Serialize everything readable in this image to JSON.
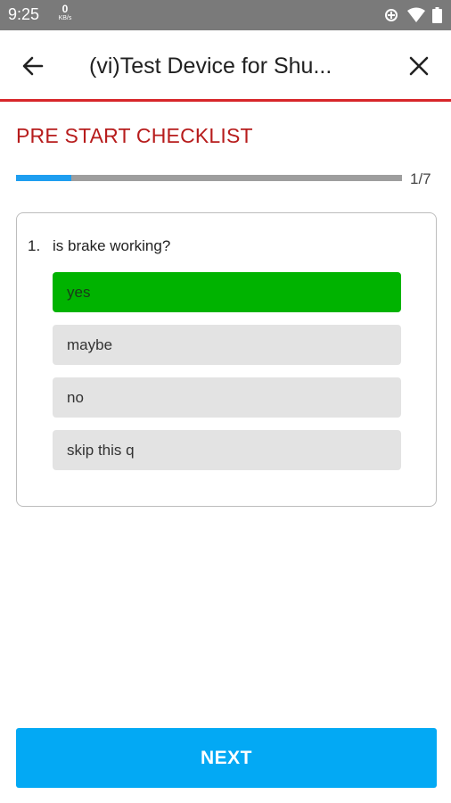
{
  "status_bar": {
    "time": "9:25",
    "net_speed_value": "0",
    "net_speed_unit": "KB/s",
    "icons": [
      "data-saver-icon",
      "wifi-icon",
      "battery-icon"
    ]
  },
  "app_bar": {
    "title": "(vi)Test Device for Shu...",
    "back_icon": "arrow-back-icon",
    "close_icon": "close-icon",
    "accent_color": "#d7262a"
  },
  "checklist": {
    "title": "PRE START CHECKLIST",
    "progress": {
      "current": 1,
      "total": 7,
      "label": "1/7",
      "fraction": 0.143
    },
    "question": {
      "number": "1.",
      "text": "is brake working?",
      "options": [
        {
          "label": "yes",
          "selected": true
        },
        {
          "label": "maybe",
          "selected": false
        },
        {
          "label": "no",
          "selected": false
        },
        {
          "label": "skip this q",
          "selected": false
        }
      ]
    }
  },
  "footer": {
    "next_label": "NEXT"
  },
  "colors": {
    "selected_option": "#00b300",
    "unselected_option": "#e3e3e3",
    "primary_button": "#03a9f4",
    "section_title": "#b71c1c",
    "progress_fill": "#1e9ef0"
  }
}
